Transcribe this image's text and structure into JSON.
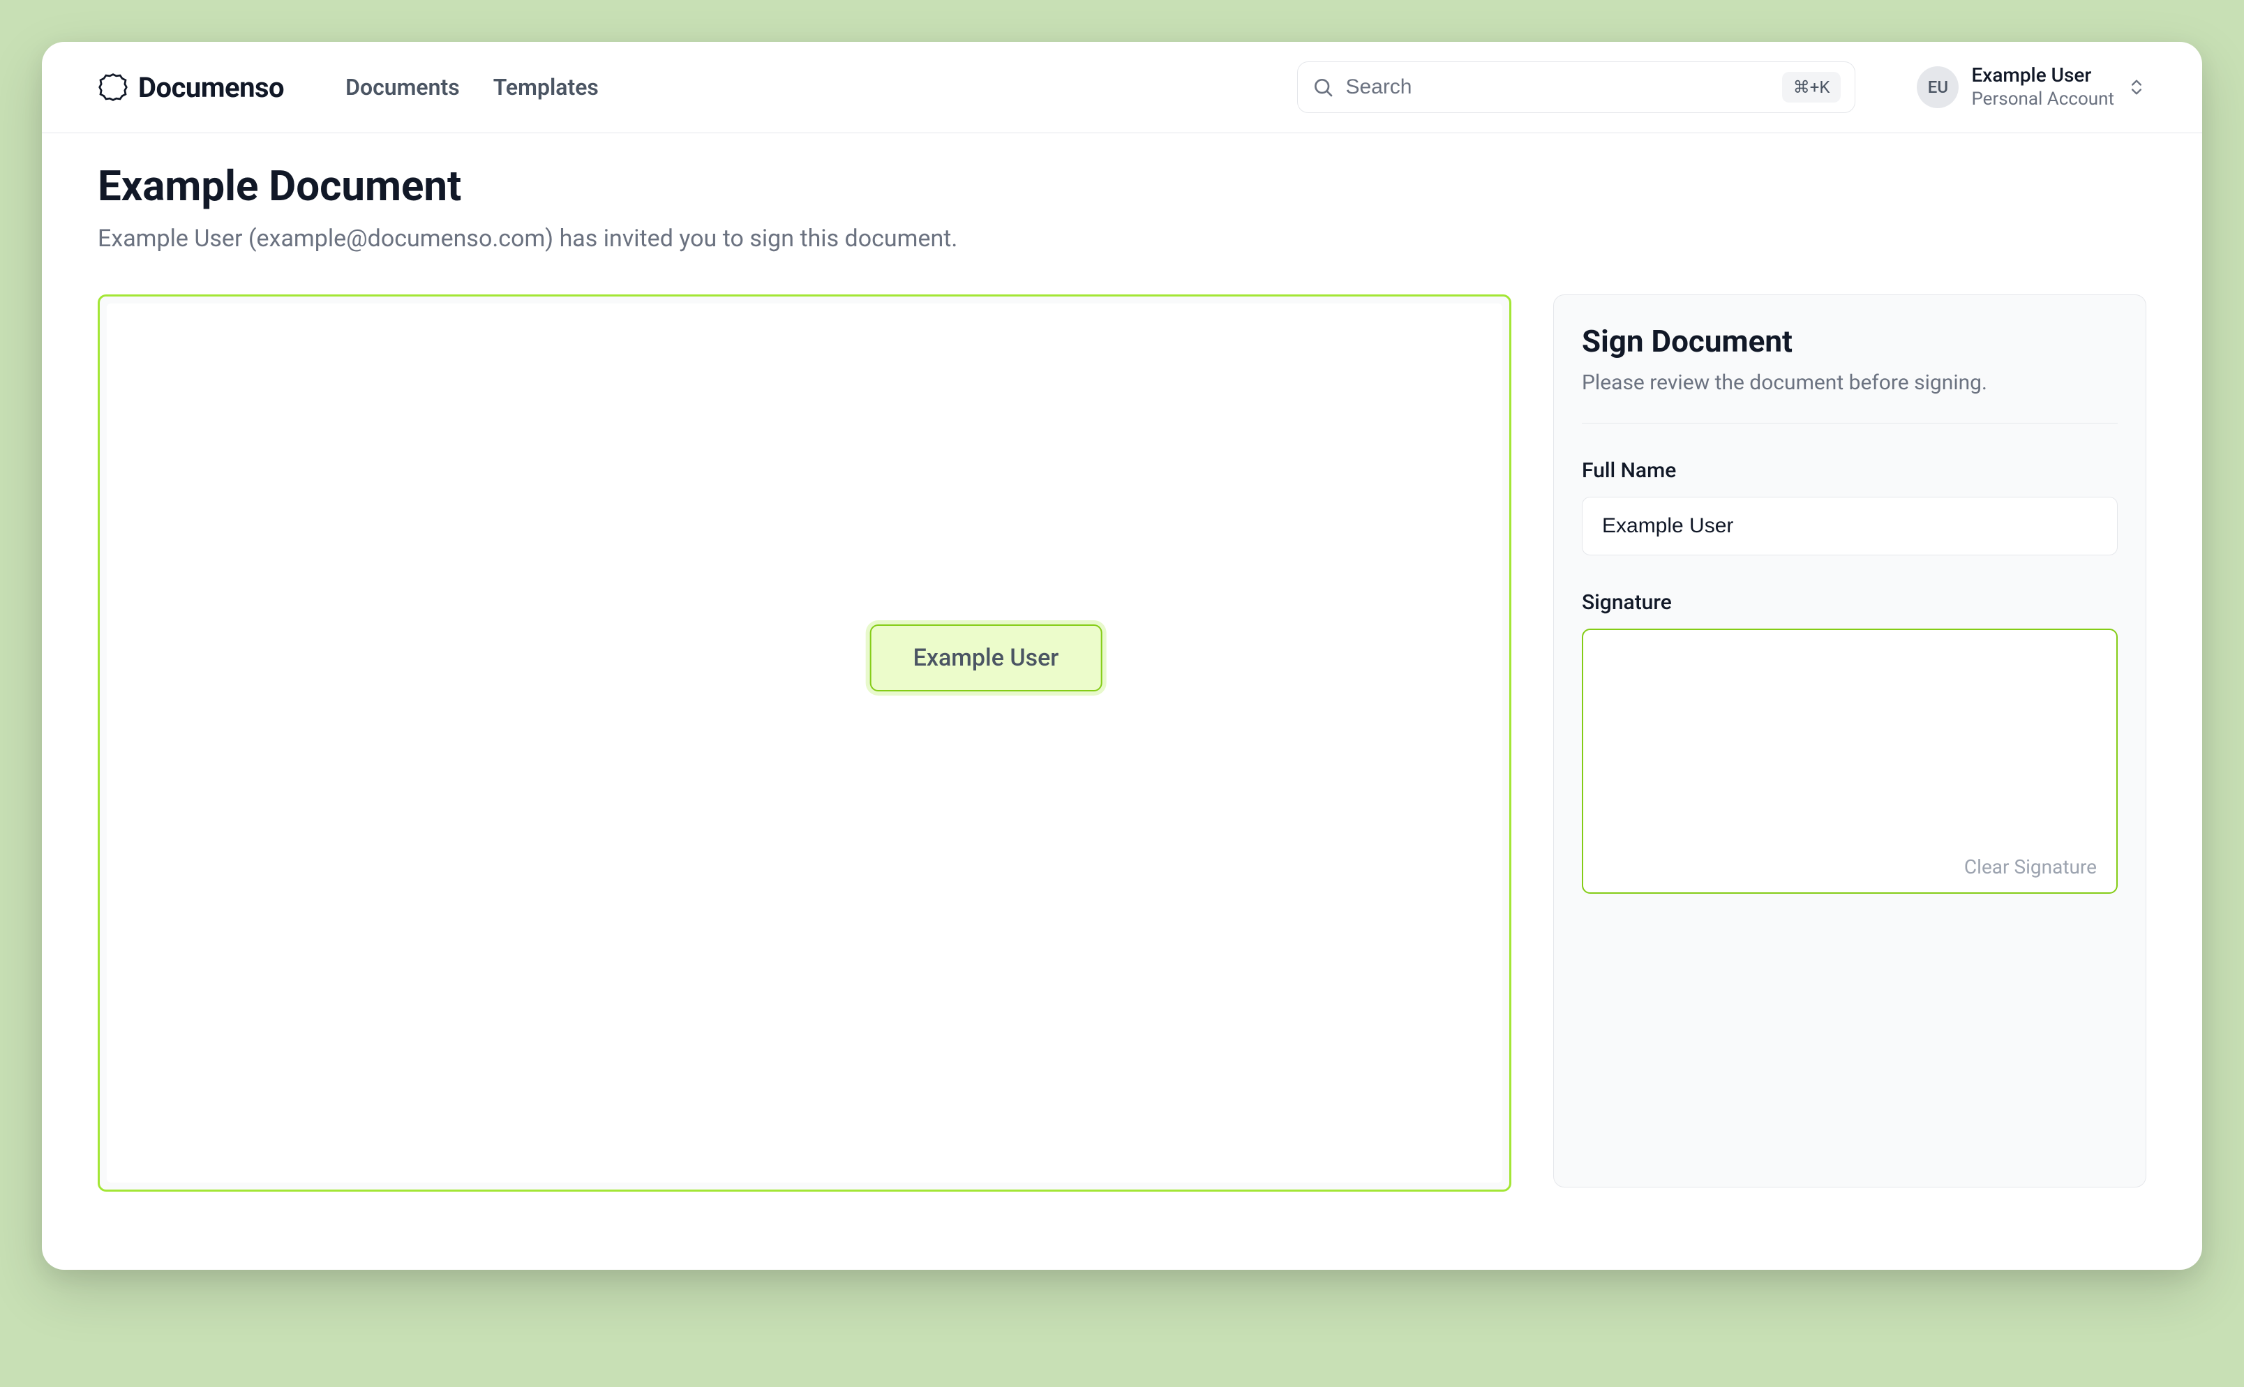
{
  "brand": {
    "name": "Documenso"
  },
  "nav": {
    "documents": "Documents",
    "templates": "Templates"
  },
  "search": {
    "placeholder": "Search",
    "shortcut": "⌘+K"
  },
  "user": {
    "initials": "EU",
    "name": "Example User",
    "account_type": "Personal Account"
  },
  "page": {
    "title": "Example Document",
    "subtitle": "Example User (example@documenso.com) has invited you to sign this document."
  },
  "document": {
    "name_field_value": "Example User"
  },
  "panel": {
    "title": "Sign Document",
    "subtitle": "Please review the document before signing.",
    "full_name_label": "Full Name",
    "full_name_value": "Example User",
    "signature_label": "Signature",
    "clear_signature": "Clear Signature"
  }
}
